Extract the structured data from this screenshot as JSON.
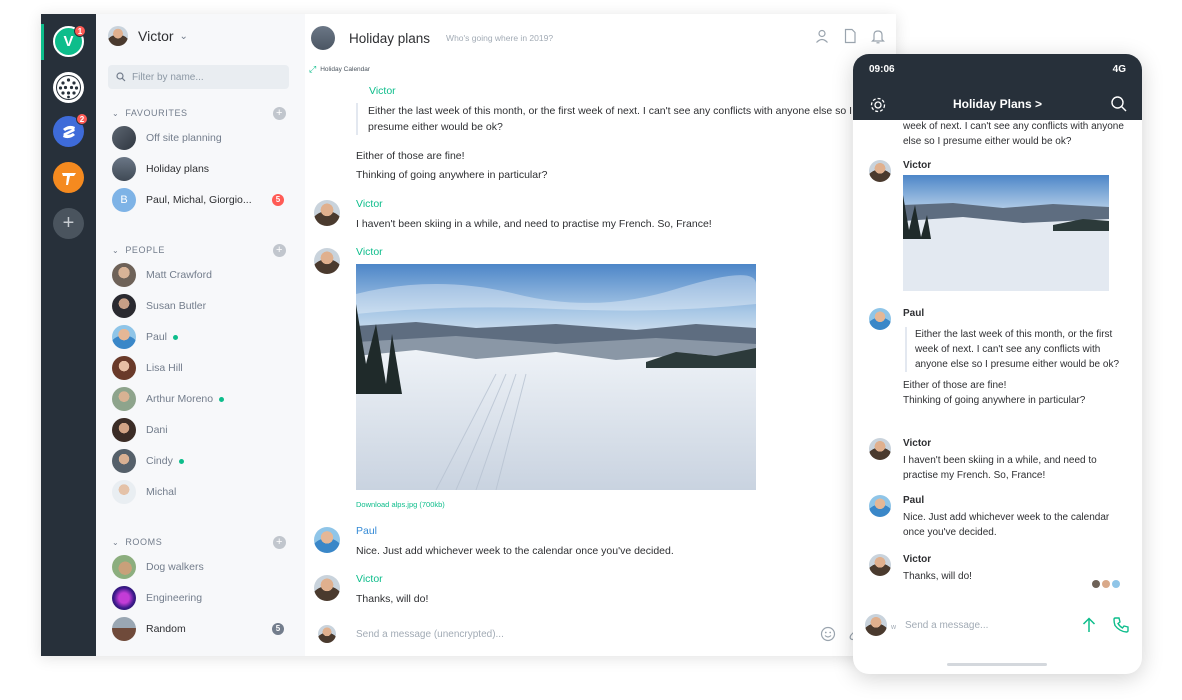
{
  "colors": {
    "accent": "#0dbd8b",
    "sidebar": "#27303a",
    "badge": "#ff5b55",
    "sender_paul": "#368bd6"
  },
  "spaces": {
    "items": [
      {
        "label": "V",
        "badge": "1",
        "icon": "user-space-avatar"
      },
      {
        "label": "",
        "badge": "",
        "icon": "ball-space-icon"
      },
      {
        "label": "",
        "badge": "2",
        "icon": "s-space-icon"
      },
      {
        "label": "",
        "badge": "",
        "icon": "t-space-icon"
      },
      {
        "label": "+",
        "badge": "",
        "icon": "add-space-icon"
      }
    ]
  },
  "user": {
    "name": "Victor",
    "chevron": "⌄"
  },
  "filter": {
    "placeholder": "Filter by name..."
  },
  "favourites": {
    "title": "FAVOURITES",
    "rooms": [
      {
        "name": "Off site planning",
        "bold": false
      },
      {
        "name": "Holiday plans",
        "bold": true
      },
      {
        "name": "Paul, Michal, Giorgio...",
        "bold": true,
        "badge": "5"
      }
    ]
  },
  "people": {
    "title": "PEOPLE",
    "rooms": [
      {
        "name": "Matt Crawford",
        "online": false
      },
      {
        "name": "Susan Butler",
        "online": false
      },
      {
        "name": "Paul",
        "online": true
      },
      {
        "name": "Lisa Hill",
        "online": false
      },
      {
        "name": "Arthur Moreno",
        "online": true
      },
      {
        "name": "Dani",
        "online": false
      },
      {
        "name": "Cindy",
        "online": true
      },
      {
        "name": "Michal",
        "online": false
      }
    ]
  },
  "rooms": {
    "title": "ROOMS",
    "rooms": [
      {
        "name": "Dog walkers",
        "bold": false
      },
      {
        "name": "Engineering",
        "bold": false
      },
      {
        "name": "Random",
        "bold": true,
        "badge": "5"
      }
    ]
  },
  "room_header": {
    "title": "Holiday plans",
    "topic": "Who's going where in 2019?",
    "breadcrumb": "Holiday Calendar",
    "icons": [
      "member-list-icon",
      "files-icon",
      "notifications-icon"
    ]
  },
  "timeline": {
    "messages": [
      {
        "sender": "Victor",
        "quote": "Either the last week of this month, or the first week of next. I can't see any conflicts with anyone else so I presume either would be ok?"
      },
      {
        "line1": "Either of those are fine!",
        "line2": "Thinking of going anywhere in particular?"
      },
      {
        "sender": "Victor",
        "text": "I haven't been skiing in a while, and need to practise my French. So, France!"
      },
      {
        "sender": "Victor",
        "download": "Download alps.jpg (700kb)"
      },
      {
        "sender": "Paul",
        "text": "Nice. Just add whichever week to the calendar once you've decided."
      },
      {
        "sender": "Victor",
        "text": "Thanks, will do!"
      }
    ]
  },
  "composer": {
    "placeholder": "Send a message (unencrypted)...",
    "icons": [
      "emoji-icon",
      "attachment-icon",
      "call-icon"
    ]
  },
  "phone": {
    "time": "09:06",
    "network": "4G",
    "title": "Holiday Plans >",
    "messages": [
      {
        "text": "week of next. I can't see any conflicts with anyone else so I presume either would be ok?"
      },
      {
        "name": "Victor"
      },
      {
        "name": "Paul",
        "quote": "Either the last week of this month, or the first week of next. I can't see any conflicts with anyone else so I presume either would be ok?",
        "line1": "Either of those are fine!",
        "line2": "Thinking of going anywhere in particular?"
      },
      {
        "name": "Victor",
        "text": "I haven't been skiing in a while, and need to practise my French. So, France!"
      },
      {
        "name": "Paul",
        "text": "Nice. Just add whichever week to the calendar once you've decided."
      },
      {
        "name": "Victor",
        "text": "Thanks, will do!"
      }
    ],
    "composer_label": "w",
    "composer_placeholder": "Send a message..."
  }
}
